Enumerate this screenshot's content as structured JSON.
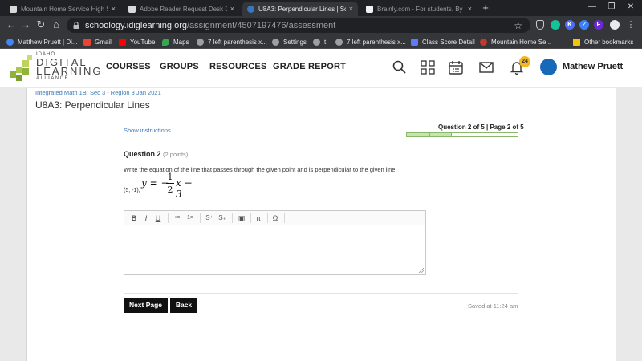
{
  "browser": {
    "tabs": [
      {
        "title": "Mountain Home Service High Sc...",
        "active": false,
        "favicon_color": "#e0e0e0"
      },
      {
        "title": "Adobe Reader Request Desk Dev...",
        "active": false,
        "favicon_color": "#e0e0e0"
      },
      {
        "title": "U8A3: Perpendicular Lines | Scho...",
        "active": true,
        "favicon_color": "#3b76bd"
      },
      {
        "title": "Brainly.com - For students. By st...",
        "active": false,
        "favicon_color": "#111111"
      }
    ],
    "tab_close": "×",
    "new_tab": "+",
    "window_controls": {
      "minimize": "—",
      "maximize": "❐",
      "close": "✕"
    },
    "nav": {
      "back": "←",
      "forward": "→",
      "reload": "↻",
      "home": "⌂"
    },
    "url": {
      "host": "schoology.idiglearning.org",
      "path": "/assignment/4507197476/assessment"
    },
    "extensions": [
      {
        "name": "shield-icon",
        "label": "",
        "color": "#8ab4f8"
      },
      {
        "name": "grammarly-icon",
        "label": "",
        "color": "#15c39a"
      },
      {
        "name": "k-extension-icon",
        "label": "K",
        "color": "#4c6ef5"
      },
      {
        "name": "check-extension-icon",
        "label": "✓",
        "color": "#3b82f6"
      },
      {
        "name": "f-extension-icon",
        "label": "F",
        "color": "#6d28d9"
      }
    ]
  },
  "bookmarks": {
    "items": [
      {
        "label": "Matthew Pruett | Di...",
        "icon": "person-icon",
        "color": "#4285f4"
      },
      {
        "label": "Gmail",
        "icon": "gmail-icon",
        "color": "#ea4335"
      },
      {
        "label": "YouTube",
        "icon": "youtube-icon",
        "color": "#ff0000"
      },
      {
        "label": "Maps",
        "icon": "maps-icon",
        "color": "#34a853"
      },
      {
        "label": "7 left parenthesis x...",
        "icon": "globe-icon",
        "color": "#9aa0a6"
      },
      {
        "label": "Settings",
        "icon": "globe-icon",
        "color": "#9aa0a6"
      },
      {
        "label": "t",
        "icon": "globe-icon",
        "color": "#9aa0a6"
      },
      {
        "label": "7 left parenthesis x...",
        "icon": "globe-icon",
        "color": "#9aa0a6"
      },
      {
        "label": "Class Score Detail",
        "icon": "p-icon",
        "color": "#5b7cfa"
      },
      {
        "label": "Mountain Home Se...",
        "icon": "school-icon",
        "color": "#c0392b"
      }
    ],
    "other": "Other bookmarks"
  },
  "header": {
    "logo": {
      "line1": "IDAHO",
      "line2": "DIGITAL",
      "line3": "LEARNING",
      "line4": "ALLIANCE"
    },
    "nav": [
      "COURSES",
      "GROUPS",
      "RESOURCES",
      "GRADE REPORT"
    ],
    "notifications_count": "24",
    "user_name": "Mathew Pruett"
  },
  "page": {
    "breadcrumb": "Integrated Math 1B: Sec 3 - Region 3 Jan 2021",
    "title": "U8A3: Perpendicular Lines",
    "show_instructions": "Show instructions",
    "progress_text": "Question 2 of 5 | Page 2 of 5",
    "progress_fraction": 0.4,
    "progress_segments": 5,
    "question": {
      "number": "Question 2",
      "points": "(2 points)",
      "text": "Write the equation of the line that passes through the given point and is perpendicular to the given line.",
      "point": "(5, -1);",
      "equation": {
        "lhs": "y = −",
        "num": "1",
        "den": "2",
        "rhs": "x − 3"
      }
    },
    "editor": {
      "toolbar": [
        "B",
        "I",
        "U",
        "•≡",
        "1≡",
        "S⁺",
        "S₊",
        "▣",
        "π",
        "Ω"
      ]
    },
    "buttons": {
      "next": "Next Page",
      "back": "Back"
    },
    "saved": "Saved at 11:24 am"
  }
}
